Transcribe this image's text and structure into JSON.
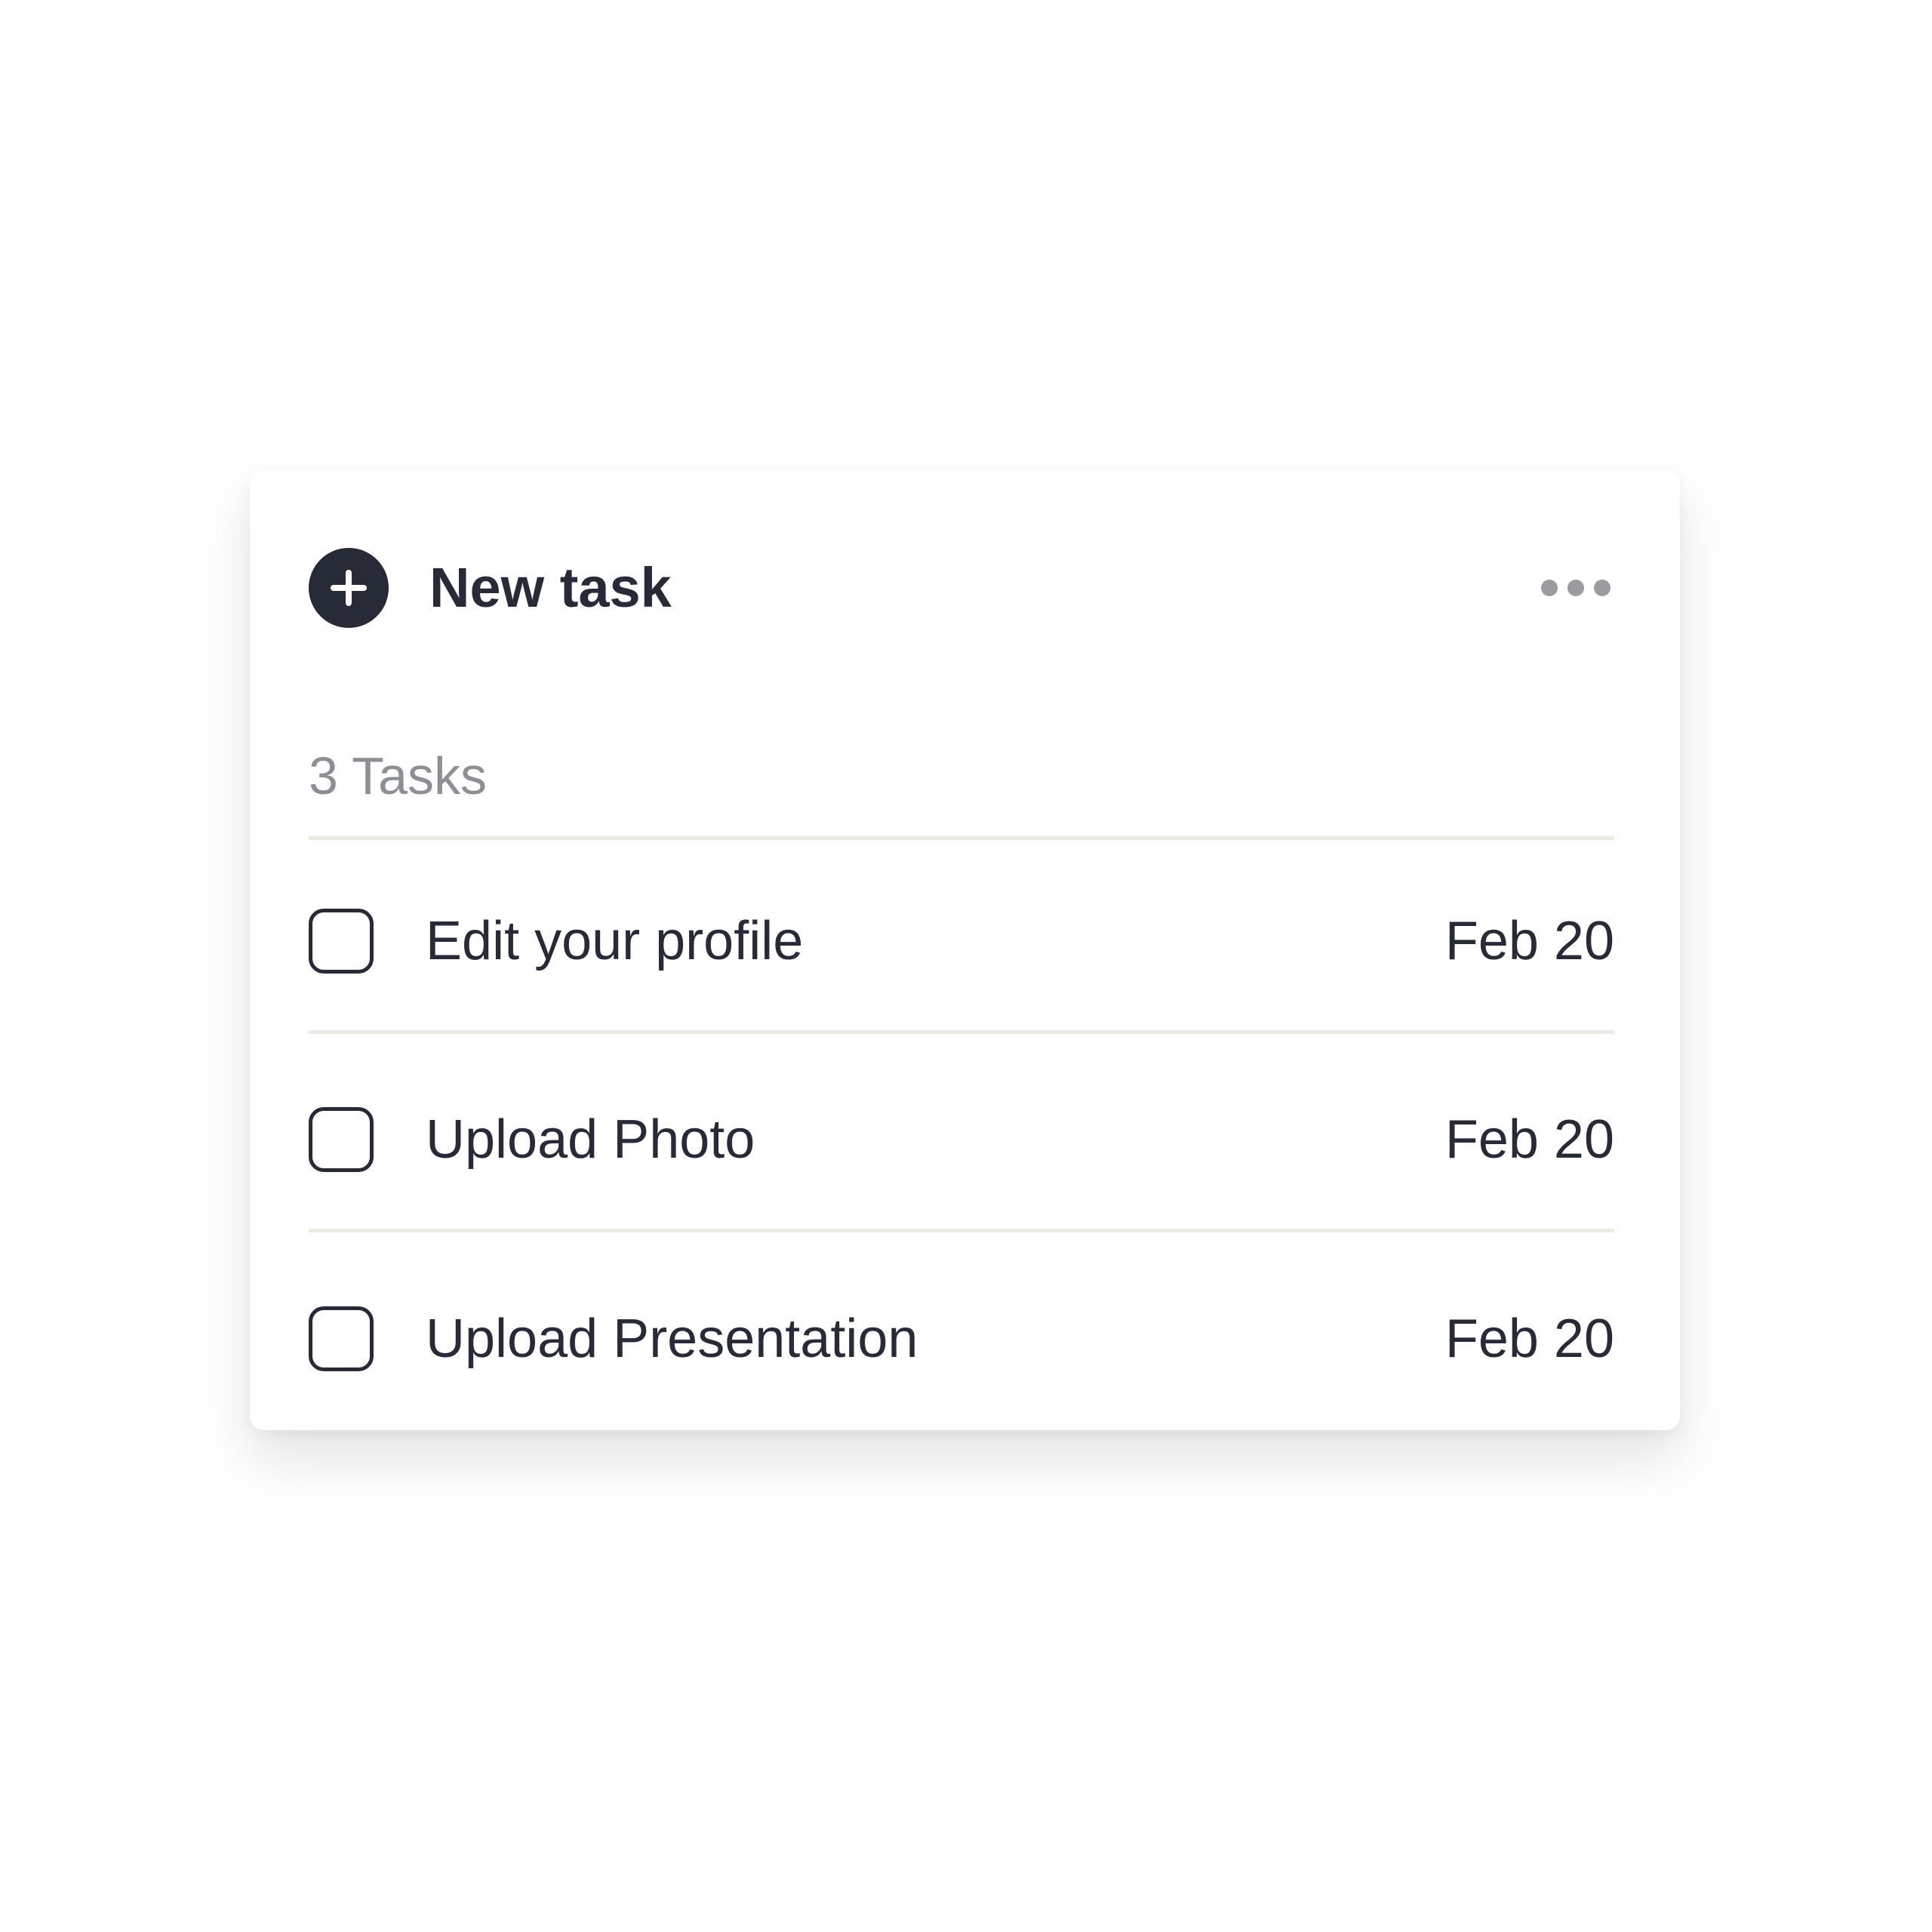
{
  "header": {
    "new_task_label": "New task",
    "add_icon": "plus-circle-icon",
    "more_icon": "more-horizontal-icon"
  },
  "list": {
    "count_label": "3 Tasks",
    "tasks": [
      {
        "name": "Edit your profile",
        "date": "Feb 20",
        "checked": false
      },
      {
        "name": "Upload Photo",
        "date": "Feb 20",
        "checked": false
      },
      {
        "name": "Upload Presentation",
        "date": "Feb 20",
        "checked": false
      }
    ]
  },
  "colors": {
    "text_primary": "#272b38",
    "text_muted": "#8c8f95",
    "icon_muted": "#9a9ca0",
    "divider": "#eceae3",
    "background": "#fefefe"
  }
}
